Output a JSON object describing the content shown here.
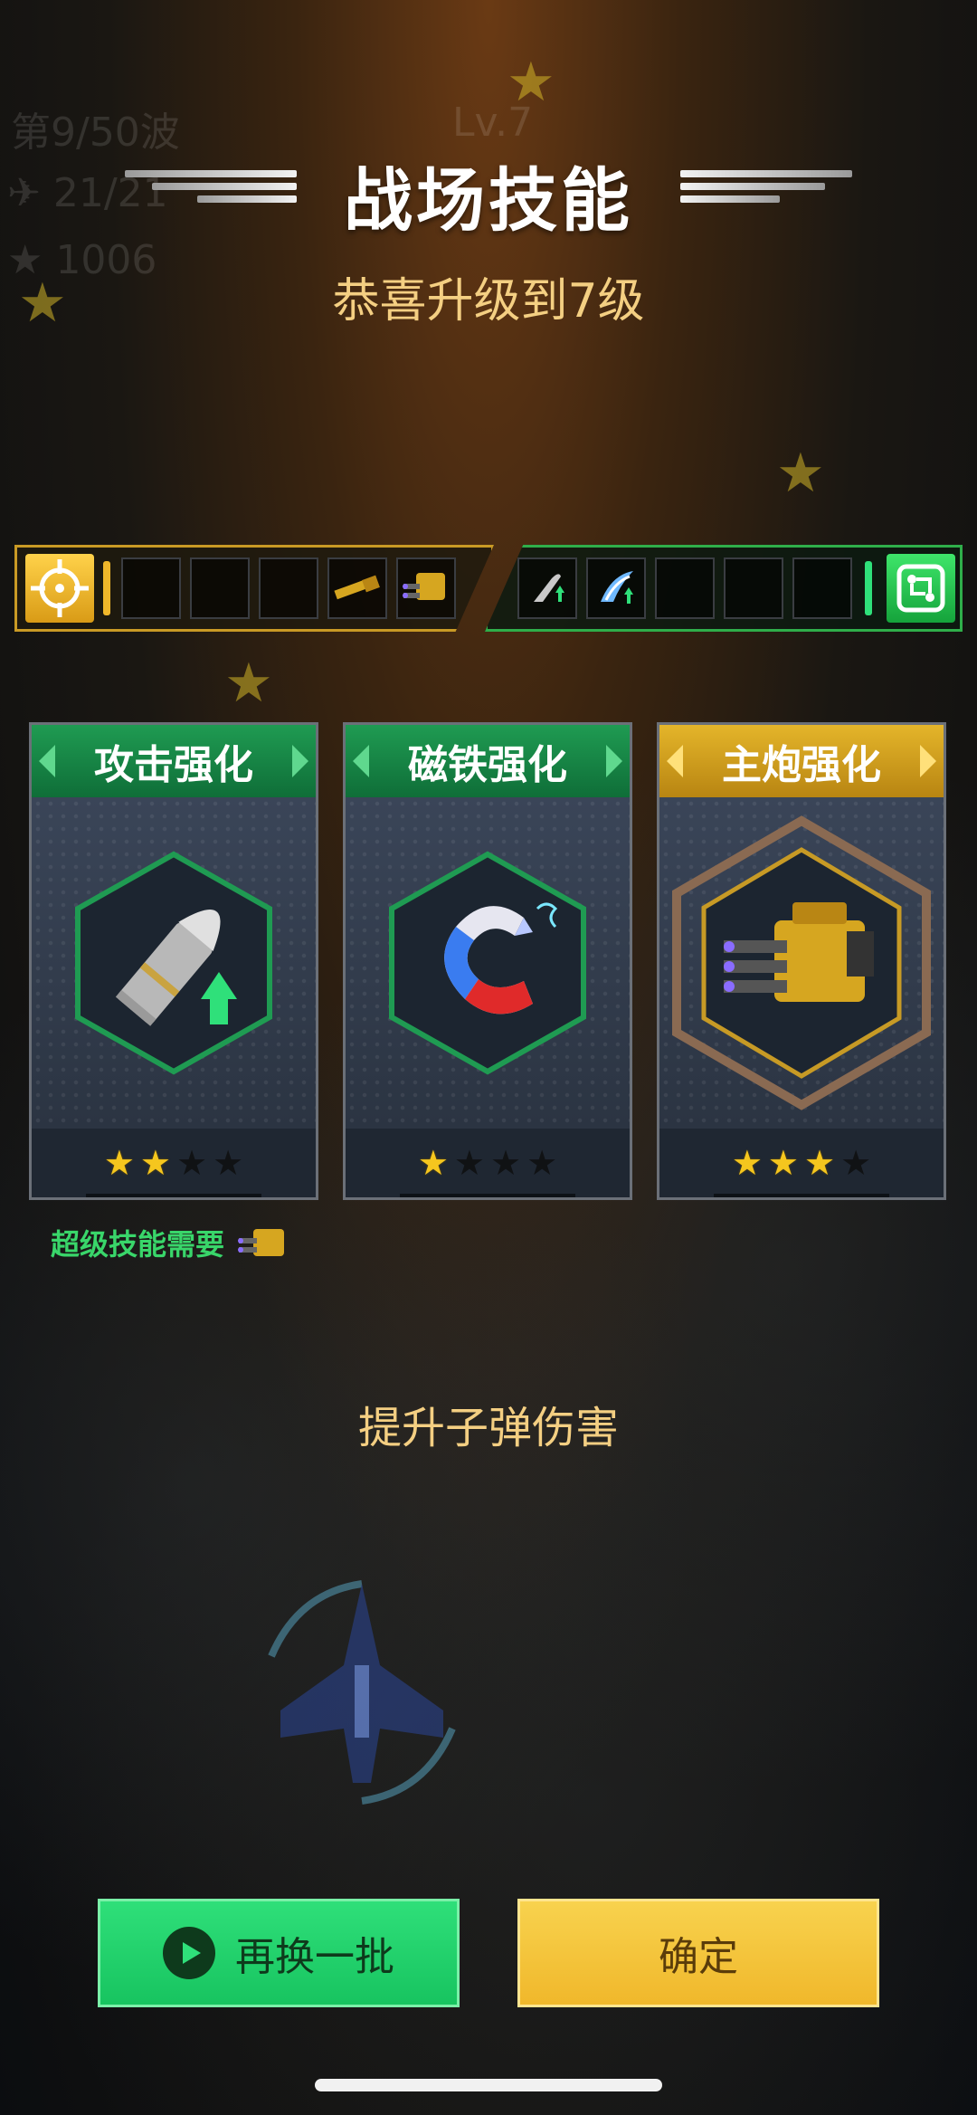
{
  "hud": {
    "wave": "第9/50波",
    "level": "Lv.7",
    "kills": "21/21",
    "score": "1006"
  },
  "header": {
    "title": "战场技能",
    "subtitle": "恭喜升级到7级"
  },
  "slots": {
    "left_items": [
      "",
      "",
      "",
      "gold-cannon-icon",
      "gatling-turret-icon"
    ],
    "right_items": [
      "bullet-up-icon",
      "blue-wing-icon",
      "",
      "",
      ""
    ]
  },
  "cards": [
    {
      "title": "攻击强化",
      "icon": "bullet-upgrade-icon",
      "stars": 2,
      "max_stars": 4,
      "theme": "green"
    },
    {
      "title": "磁铁强化",
      "icon": "magnet-icon",
      "stars": 1,
      "max_stars": 4,
      "theme": "green"
    },
    {
      "title": "主炮强化",
      "icon": "gatling-turret-icon",
      "stars": 3,
      "max_stars": 4,
      "theme": "gold"
    }
  ],
  "requirement": {
    "label": "超级技能需要"
  },
  "description": "提升子弹伤害",
  "buttons": {
    "refresh_label": "再换一批",
    "confirm_label": "确定"
  },
  "colors": {
    "accent_gold": "#f4cf82",
    "green": "#2fe07a",
    "gold": "#f0b72a"
  }
}
